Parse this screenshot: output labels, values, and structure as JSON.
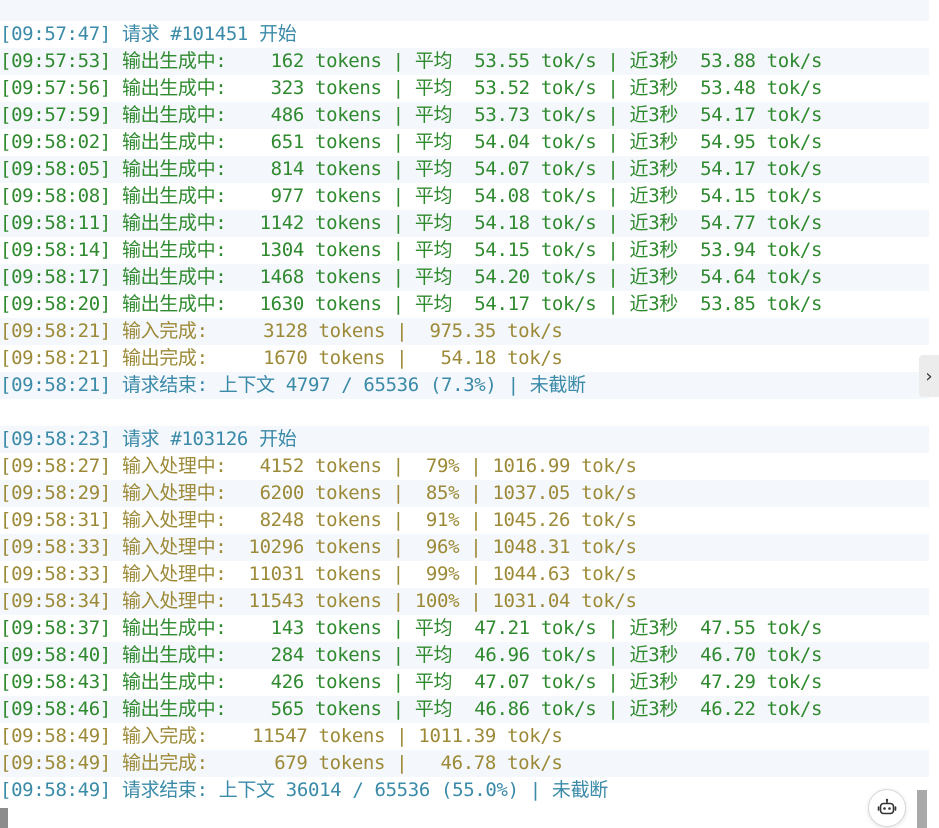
{
  "log_lines": [
    {
      "text": "[09:57:47] 请求 #101451 开始",
      "color": "teal"
    },
    {
      "text": "[09:57:53] 输出生成中:    162 tokens | 平均  53.55 tok/s | 近3秒  53.88 tok/s",
      "color": "green"
    },
    {
      "text": "[09:57:56] 输出生成中:    323 tokens | 平均  53.52 tok/s | 近3秒  53.48 tok/s",
      "color": "green"
    },
    {
      "text": "[09:57:59] 输出生成中:    486 tokens | 平均  53.73 tok/s | 近3秒  54.17 tok/s",
      "color": "green"
    },
    {
      "text": "[09:58:02] 输出生成中:    651 tokens | 平均  54.04 tok/s | 近3秒  54.95 tok/s",
      "color": "green"
    },
    {
      "text": "[09:58:05] 输出生成中:    814 tokens | 平均  54.07 tok/s | 近3秒  54.17 tok/s",
      "color": "green"
    },
    {
      "text": "[09:58:08] 输出生成中:    977 tokens | 平均  54.08 tok/s | 近3秒  54.15 tok/s",
      "color": "green"
    },
    {
      "text": "[09:58:11] 输出生成中:   1142 tokens | 平均  54.18 tok/s | 近3秒  54.77 tok/s",
      "color": "green"
    },
    {
      "text": "[09:58:14] 输出生成中:   1304 tokens | 平均  54.15 tok/s | 近3秒  53.94 tok/s",
      "color": "green"
    },
    {
      "text": "[09:58:17] 输出生成中:   1468 tokens | 平均  54.20 tok/s | 近3秒  54.64 tok/s",
      "color": "green"
    },
    {
      "text": "[09:58:20] 输出生成中:   1630 tokens | 平均  54.17 tok/s | 近3秒  53.85 tok/s",
      "color": "green"
    },
    {
      "text": "[09:58:21] 输入完成:     3128 tokens |  975.35 tok/s",
      "color": "olive"
    },
    {
      "text": "[09:58:21] 输出完成:     1670 tokens |   54.18 tok/s",
      "color": "olive"
    },
    {
      "text": "[09:58:21] 请求结束: 上下文 4797 / 65536 (7.3%) | 未截断",
      "color": "teal"
    },
    {
      "text": "",
      "color": "blank"
    },
    {
      "text": "[09:58:23] 请求 #103126 开始",
      "color": "teal"
    },
    {
      "text": "[09:58:27] 输入处理中:   4152 tokens |  79% | 1016.99 tok/s",
      "color": "olive"
    },
    {
      "text": "[09:58:29] 输入处理中:   6200 tokens |  85% | 1037.05 tok/s",
      "color": "olive"
    },
    {
      "text": "[09:58:31] 输入处理中:   8248 tokens |  91% | 1045.26 tok/s",
      "color": "olive"
    },
    {
      "text": "[09:58:33] 输入处理中:  10296 tokens |  96% | 1048.31 tok/s",
      "color": "olive"
    },
    {
      "text": "[09:58:33] 输入处理中:  11031 tokens |  99% | 1044.63 tok/s",
      "color": "olive"
    },
    {
      "text": "[09:58:34] 输入处理中:  11543 tokens | 100% | 1031.04 tok/s",
      "color": "olive"
    },
    {
      "text": "[09:58:37] 输出生成中:    143 tokens | 平均  47.21 tok/s | 近3秒  47.55 tok/s",
      "color": "green"
    },
    {
      "text": "[09:58:40] 输出生成中:    284 tokens | 平均  46.96 tok/s | 近3秒  46.70 tok/s",
      "color": "green"
    },
    {
      "text": "[09:58:43] 输出生成中:    426 tokens | 平均  47.07 tok/s | 近3秒  47.29 tok/s",
      "color": "green"
    },
    {
      "text": "[09:58:46] 输出生成中:    565 tokens | 平均  46.86 tok/s | 近3秒  46.22 tok/s",
      "color": "green"
    },
    {
      "text": "[09:58:49] 输入完成:    11547 tokens | 1011.39 tok/s",
      "color": "olive"
    },
    {
      "text": "[09:58:49] 输出完成:      679 tokens |   46.78 tok/s",
      "color": "olive"
    },
    {
      "text": "[09:58:49] 请求结束: 上下文 36014 / 65536 (55.0%) | 未截断",
      "color": "teal"
    }
  ],
  "colors": {
    "green": "#2f8a2f",
    "olive": "#9c8a38",
    "teal": "#3a8aa8",
    "stripe": "#f4f7fb"
  },
  "controls": {
    "expand_tab_icon": "chevron-right-icon",
    "expand_tab_glyph": "›",
    "bot_button_icon": "robot-icon"
  }
}
